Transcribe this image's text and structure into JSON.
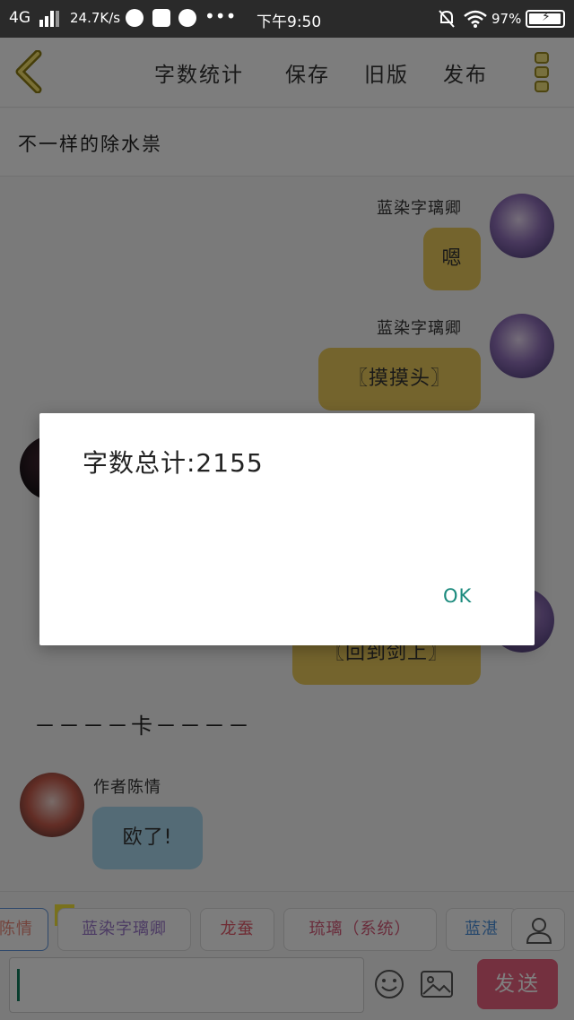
{
  "status_bar": {
    "network": "4G",
    "speed": "24.7K/s",
    "time": "下午9:50",
    "battery_text": "97%",
    "battery_level": 0.97,
    "icons": [
      "signal-icon",
      "planet-app-icon",
      "bag-app-icon",
      "palette-app-icon",
      "more-dots-icon",
      "mute-bell-icon",
      "wifi-icon",
      "battery-icon"
    ]
  },
  "toolbar": {
    "back_icon": "chevron-left-icon",
    "word_count_label": "字数统计",
    "save_label": "保存",
    "old_version_label": "旧版",
    "publish_label": "发布",
    "more_icon": "menu-icon"
  },
  "story_title": "不一样的除水祟",
  "chat": {
    "messages": [
      {
        "side": "right",
        "name": "蓝染字璃卿",
        "text": "嗯",
        "color": "#e8c95a"
      },
      {
        "side": "right",
        "name": "蓝染字璃卿",
        "text": "〖摸摸头〗",
        "color": "#e8c95a"
      },
      {
        "side": "right",
        "name": "",
        "text": "〖回到剑上〗",
        "color": "#e8c95a"
      },
      {
        "side": "left",
        "name": "作者陈情",
        "text": "欧了!",
        "color": "#a9d6ec"
      }
    ],
    "divider": "－－－－卡－－－－"
  },
  "roles": {
    "host_badge": "主",
    "items": [
      {
        "label": "陈情",
        "color": "#e8897a"
      },
      {
        "label": "蓝染字璃卿",
        "color": "#9a78c8"
      },
      {
        "label": "龙蚕",
        "color": "#e05a6a"
      },
      {
        "label": "琉璃（系统）",
        "color": "#d45a78"
      },
      {
        "label": "蓝湛",
        "color": "#4a8ed8"
      }
    ],
    "person_icon": "person-icon"
  },
  "composer": {
    "emoji_icon": "smile-icon",
    "image_icon": "image-icon",
    "send_label": "发送",
    "accent": "#e8607e"
  },
  "dialog": {
    "message": "字数总计:2155",
    "ok_label": "OK"
  }
}
